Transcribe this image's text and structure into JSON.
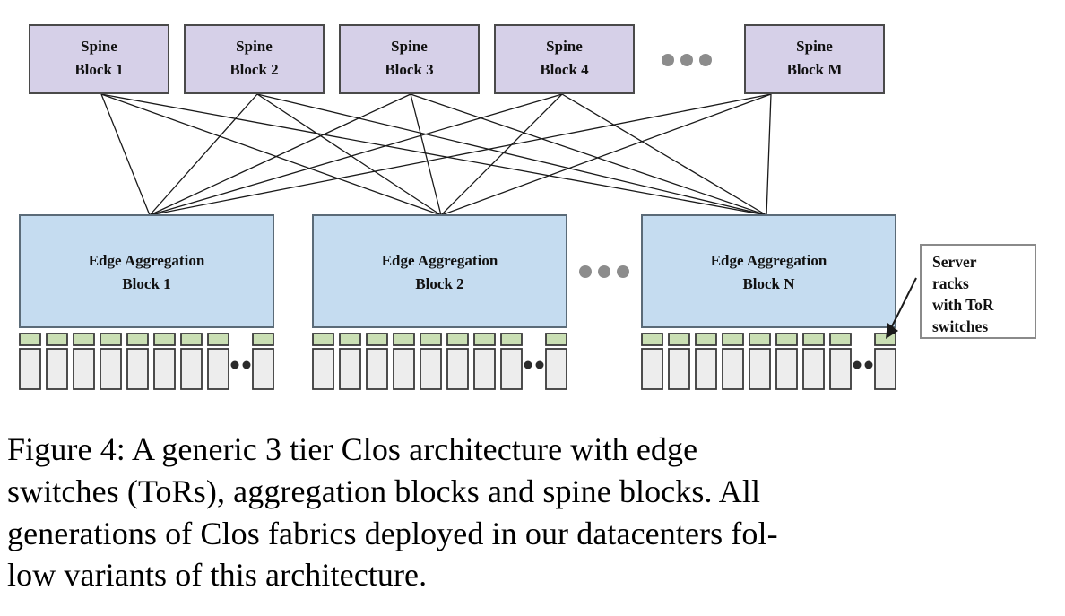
{
  "figure": {
    "spine_tier": {
      "ellipsis": "• • •",
      "blocks": [
        {
          "line1": "Spine",
          "line2": "Block 1"
        },
        {
          "line1": "Spine",
          "line2": "Block 2"
        },
        {
          "line1": "Spine",
          "line2": "Block 3"
        },
        {
          "line1": "Spine",
          "line2": "Block 4"
        },
        {
          "line1": "Spine",
          "line2": "Block M"
        }
      ]
    },
    "aggregation_tier": {
      "ellipsis": "• • •",
      "blocks": [
        {
          "line1": "Edge Aggregation",
          "line2": "Block 1"
        },
        {
          "line1": "Edge Aggregation",
          "line2": "Block 2"
        },
        {
          "line1": "Edge Aggregation",
          "line2": "Block N"
        }
      ]
    },
    "rack_tier": {
      "racks_before_ellipsis": 8,
      "racks_after_ellipsis": 1,
      "ellipsis": "• • •"
    },
    "callout": {
      "line1": "Server",
      "line2": "racks",
      "line3": "with ToR",
      "line4": "switches"
    },
    "colors": {
      "spine_fill": "#d6d0e8",
      "spine_stroke": "#4a4a4a",
      "aggregation_fill": "#c5dcf0",
      "aggregation_stroke": "#5b6b78",
      "tor_fill": "#cadfb4",
      "tor_stroke": "#3a3a3a",
      "rack_fill": "#ededed",
      "rack_stroke": "#3a3a3a",
      "link_stroke": "#1a1a1a",
      "dot_fill": "#8c8c8c",
      "callout_stroke": "#8a8a8a",
      "text": "#111111"
    }
  },
  "caption": {
    "line1": "Figure 4:   A generic 3 tier Clos architecture with edge",
    "line2": "switches (ToRs), aggregation blocks and spine blocks.  All",
    "line3": "generations of Clos fabrics deployed in our datacenters fol-",
    "line4": "low variants of this architecture."
  }
}
